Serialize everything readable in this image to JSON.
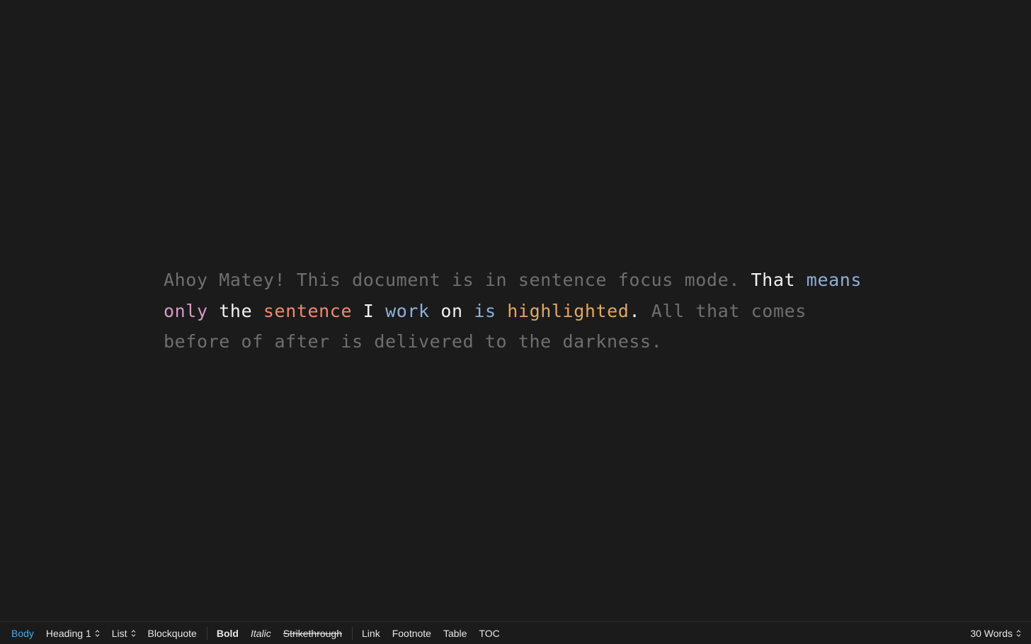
{
  "colors": {
    "dimmed": "#6f6f6f",
    "plain": "#f2f2f2",
    "blue": "#8fb0d8",
    "pink": "#d59ac6",
    "salmon": "#f08a72",
    "orange": "#e3a766",
    "accent": "#4aa8ec",
    "background": "#1b1b1b"
  },
  "document": {
    "before": "Ahoy Matey! This document is in sentence focus mode. ",
    "focus": [
      {
        "text": "That",
        "color": "#f2f2f2"
      },
      {
        "text": " ",
        "color": "#f2f2f2"
      },
      {
        "text": "means",
        "color": "#8fb0d8"
      },
      {
        "text": " ",
        "color": "#f2f2f2"
      },
      {
        "text": "only",
        "color": "#d59ac6"
      },
      {
        "text": " ",
        "color": "#f2f2f2"
      },
      {
        "text": "the",
        "color": "#f2f2f2"
      },
      {
        "text": " ",
        "color": "#f2f2f2"
      },
      {
        "text": "sentence",
        "color": "#f08a72"
      },
      {
        "text": " ",
        "color": "#f2f2f2"
      },
      {
        "text": "I",
        "color": "#f2f2f2"
      },
      {
        "text": " ",
        "color": "#f2f2f2"
      },
      {
        "text": "work",
        "color": "#8fb0d8"
      },
      {
        "text": " ",
        "color": "#f2f2f2"
      },
      {
        "text": "on",
        "color": "#f2f2f2"
      },
      {
        "text": " ",
        "color": "#f2f2f2"
      },
      {
        "text": "is",
        "color": "#8fb0d8"
      },
      {
        "text": " ",
        "color": "#f2f2f2"
      },
      {
        "text": "highlighted",
        "color": "#e3a766"
      },
      {
        "text": ".",
        "color": "#f2f2f2"
      }
    ],
    "after": " All that comes before of after is delivered to the darkness."
  },
  "toolbar": {
    "body": "Body",
    "heading": "Heading 1",
    "list": "List",
    "blockquote": "Blockquote",
    "bold": "Bold",
    "italic": "Italic",
    "strikethrough": "Strikethrough",
    "link": "Link",
    "footnote": "Footnote",
    "table": "Table",
    "toc": "TOC",
    "word_count": "30 Words",
    "stepper_icon": "up-down-chevron-icon"
  }
}
